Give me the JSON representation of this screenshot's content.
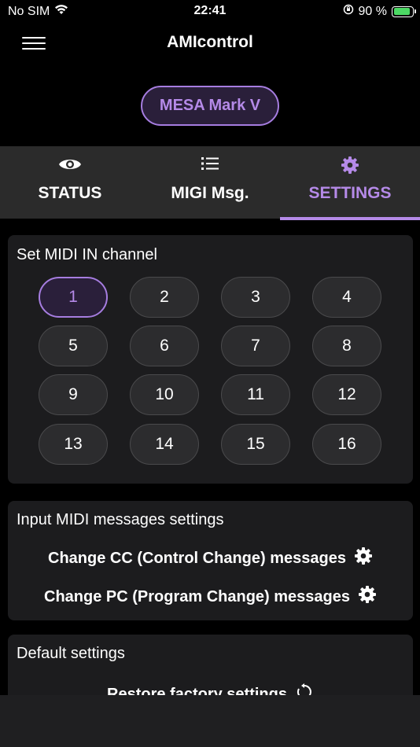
{
  "status_bar": {
    "carrier": "No SIM",
    "time": "22:41",
    "battery_percent": "90 %",
    "battery_level": 0.9,
    "icons": [
      "wifi-icon",
      "orientation-lock-icon",
      "battery-charging-icon"
    ]
  },
  "nav": {
    "title": "AMIcontrol",
    "menu_icon": "hamburger-menu-icon"
  },
  "device": {
    "name": "MESA Mark V"
  },
  "tabs": [
    {
      "label": "STATUS",
      "icon": "eye-icon",
      "active": false
    },
    {
      "label": "MIGI Msg.",
      "icon": "list-icon",
      "active": false
    },
    {
      "label": "SETTINGS",
      "icon": "gear-icon",
      "active": true
    }
  ],
  "midi_in": {
    "title": "Set MIDI IN channel",
    "selected": "1",
    "channels": [
      "1",
      "2",
      "3",
      "4",
      "5",
      "6",
      "7",
      "8",
      "9",
      "10",
      "11",
      "12",
      "13",
      "14",
      "15",
      "16"
    ]
  },
  "input_settings": {
    "title": "Input MIDI messages settings",
    "cc_label": "Change CC (Control Change) messages",
    "pc_label": "Change PC (Program Change) messages"
  },
  "defaults": {
    "title": "Default settings",
    "restore_label": "Restore factory settings"
  },
  "colors": {
    "accent": "#b58ae8",
    "background": "#000000",
    "card": "#1c1c1e",
    "tab_bar": "#2b2b2b"
  }
}
